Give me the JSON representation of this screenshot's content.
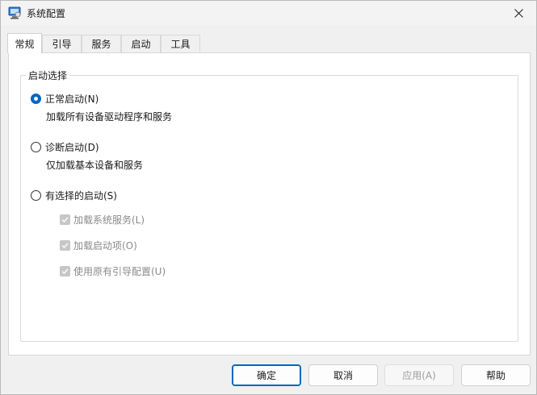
{
  "window": {
    "title": "系统配置",
    "icon": "msconfig-icon"
  },
  "tabs": [
    {
      "label": "常规",
      "active": true
    },
    {
      "label": "引导",
      "active": false
    },
    {
      "label": "服务",
      "active": false
    },
    {
      "label": "启动",
      "active": false
    },
    {
      "label": "工具",
      "active": false
    }
  ],
  "startup_selection": {
    "legend": "启动选择",
    "normal": {
      "label": "正常启动(N)",
      "desc": "加载所有设备驱动程序和服务",
      "checked": true
    },
    "diagnostic": {
      "label": "诊断启动(D)",
      "desc": "仅加载基本设备和服务",
      "checked": false
    },
    "selective": {
      "label": "有选择的启动(S)",
      "checked": false,
      "options": [
        {
          "label": "加载系统服务(L)",
          "checked": true,
          "enabled": false
        },
        {
          "label": "加载启动项(O)",
          "checked": true,
          "enabled": false
        },
        {
          "label": "使用原有引导配置(U)",
          "checked": true,
          "enabled": false
        }
      ]
    }
  },
  "buttons": {
    "ok": "确定",
    "cancel": "取消",
    "apply": "应用(A)",
    "help": "帮助"
  },
  "colors": {
    "accent": "#0067c0",
    "disabled_text": "#8a8a8a"
  }
}
